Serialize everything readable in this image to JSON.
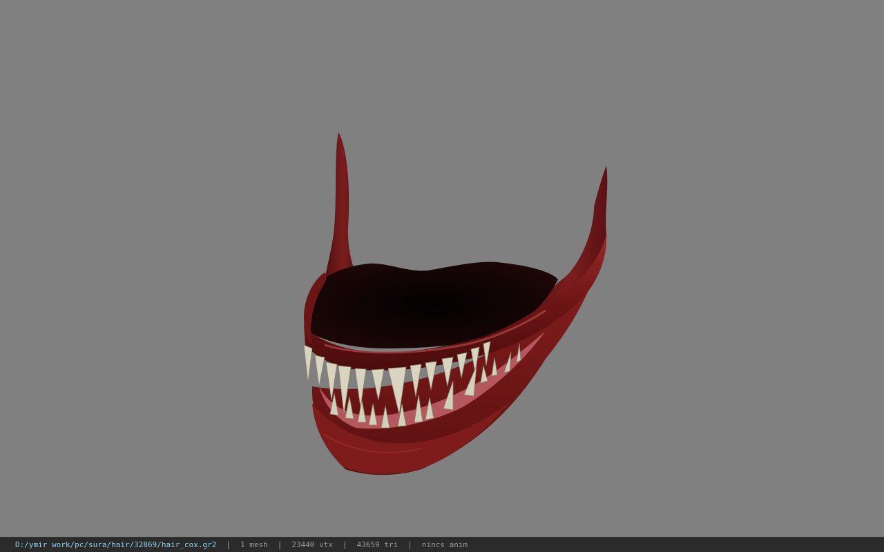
{
  "viewport": {
    "background": "#808080",
    "model_name": "hair_cox"
  },
  "colors": {
    "lip": "#7a1a1a",
    "lip_highlight": "#a83a3a",
    "mouth_interior": "#0a0606",
    "teeth": "#d9d4c0",
    "gum": "#c77a80",
    "status_bg": "#2b2b2b",
    "path_text": "#8fd0e8",
    "stat_text": "#9a9a9a"
  },
  "status": {
    "path": "D:/ymir work/pc/sura/hair/32869/hair_cox.gr2",
    "separator": "|",
    "mesh": "1 mesh",
    "vtx": "23440 vtx",
    "tri": "43659 tri",
    "anim": "nincs anim"
  }
}
